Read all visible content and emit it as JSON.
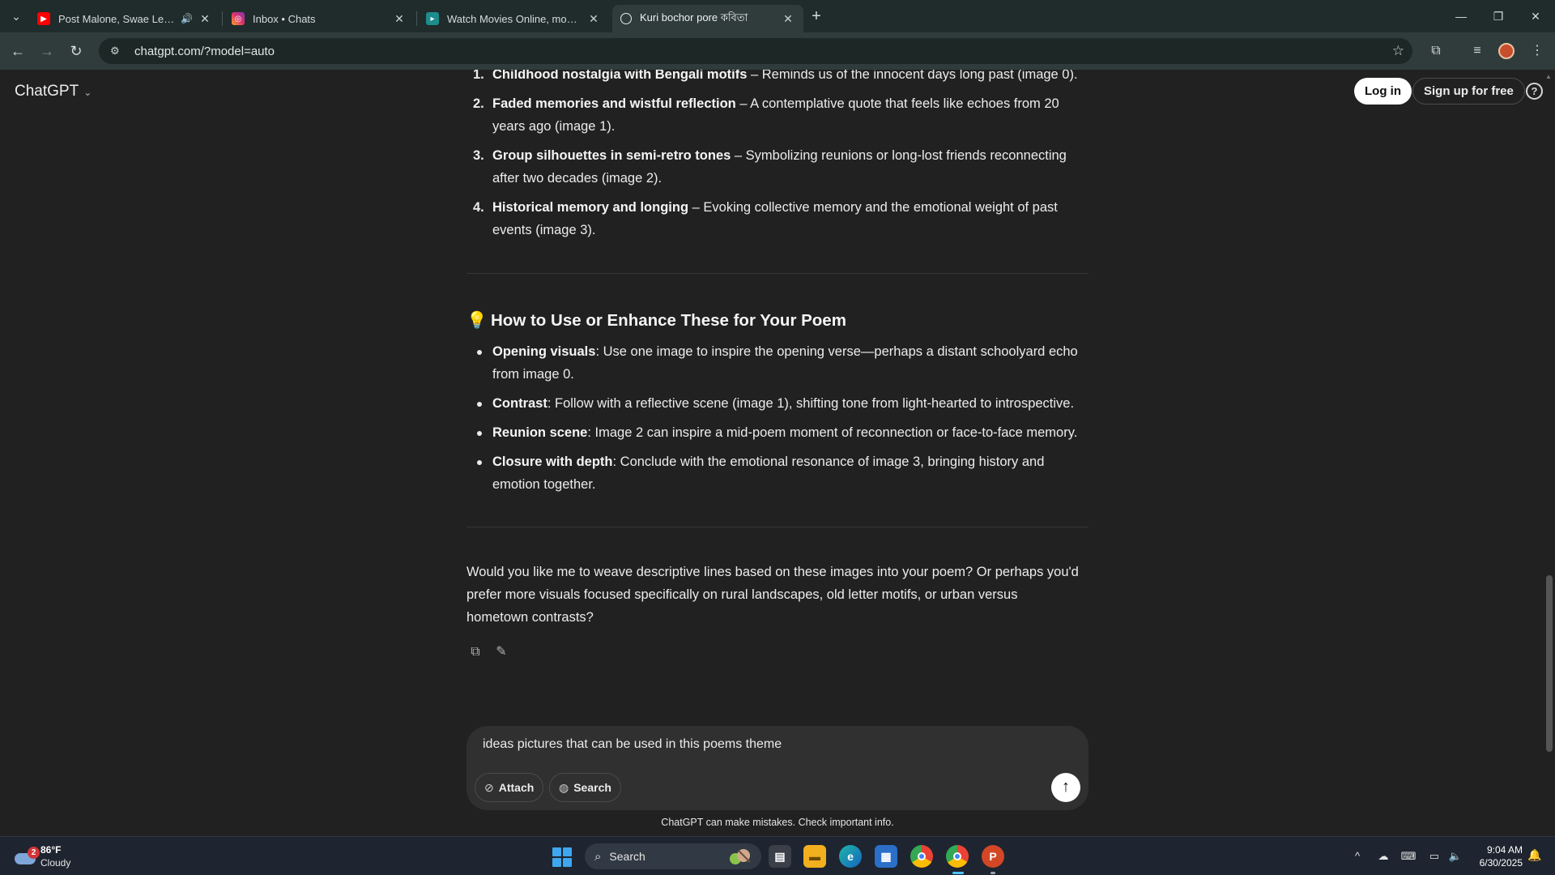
{
  "browser": {
    "tabs": [
      {
        "title": "Post Malone, Swae Lee - Sunflower",
        "close": "✕"
      },
      {
        "title": "Inbox • Chats",
        "close": "✕"
      },
      {
        "title": "Watch Movies Online, movies stream",
        "close": "✕"
      },
      {
        "title": "Kuri bochor pore কবিতা",
        "close": "✕"
      }
    ],
    "new_tab": "+",
    "url": "chatgpt.com/?model=auto"
  },
  "chat": {
    "brand": "ChatGPT",
    "login_label": "Log in",
    "signup_label": "Sign up for free",
    "help_label": "?",
    "numbered_list": [
      {
        "num": "1.",
        "bold": "Childhood nostalgia with Bengali motifs",
        "rest": " – Reminds us of the innocent days long past (image 0)."
      },
      {
        "num": "2.",
        "bold": "Faded memories and wistful reflection",
        "rest": " – A contemplative quote that feels like echoes from 20 years ago (image 1)."
      },
      {
        "num": "3.",
        "bold": "Group silhouettes in semi-retro tones",
        "rest": " – Symbolizing reunions or long-lost friends reconnecting after two decades (image 2)."
      },
      {
        "num": "4.",
        "bold": "Historical memory and longing",
        "rest": " – Evoking collective memory and the emotional weight of past events (image 3)."
      }
    ],
    "section_heading": "How to Use or Enhance These for Your Poem",
    "bullets": [
      {
        "bold": "Opening visuals",
        "rest": ": Use one image to inspire the opening verse—perhaps a distant schoolyard echo from image 0."
      },
      {
        "bold": "Contrast",
        "rest": ": Follow with a reflective scene (image 1), shifting tone from light-hearted to introspective."
      },
      {
        "bold": "Reunion scene",
        "rest": ": Image 2 can inspire a mid-poem moment of reconnection or face-to-face memory."
      },
      {
        "bold": "Closure with depth",
        "rest": ": Conclude with the emotional resonance of image 3, bringing history and emotion together."
      }
    ],
    "closing": "Would you like me to weave descriptive lines based on these images into your poem? Or perhaps you'd prefer more visuals focused specifically on rural landscapes, old letter motifs, or urban versus hometown contrasts?",
    "composer_text": "ideas pictures that can be used in this poems theme",
    "attach_label": "Attach",
    "search_label": "Search",
    "disclaimer": "ChatGPT can make mistakes. Check important info."
  },
  "taskbar": {
    "weather_badge": "2",
    "temperature": "86°F",
    "condition": "Cloudy",
    "search_label": "Search",
    "time": "9:04 AM",
    "date": "6/30/2025"
  },
  "colors": {
    "page_bg": "#212121",
    "tab_strip": "#1f2c2b",
    "toolbar": "#2f3c3b",
    "composer": "#303030",
    "taskbar": "#1e2530"
  },
  "icons": [
    "tab-search-icon",
    "youtube-icon",
    "instagram-icon",
    "movie-site-icon",
    "chatgpt-icon",
    "speaker-icon",
    "back-icon",
    "forward-icon",
    "reload-icon",
    "site-settings-icon",
    "bookmark-star-icon",
    "extensions-icon",
    "media-control-icon",
    "kebab-menu-icon",
    "chevron-down-icon",
    "help-icon",
    "lightbulb-icon",
    "copy-icon",
    "edit-icon",
    "paperclip-icon",
    "globe-icon",
    "arrow-up-icon",
    "windows-start-icon",
    "search-icon"
  ]
}
